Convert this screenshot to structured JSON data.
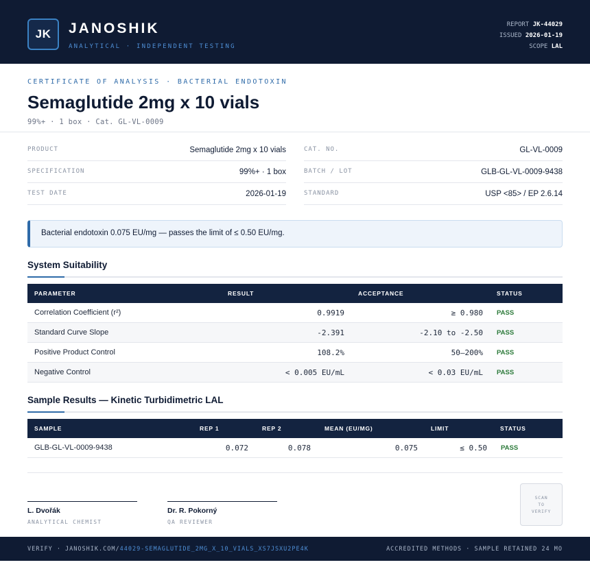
{
  "header": {
    "logo_text": "JK",
    "brand": "JANOSHIK",
    "brand_sub": "ANALYTICAL · INDEPENDENT TESTING",
    "report_label": "REPORT",
    "report_value": "JK-44029",
    "issued_label": "ISSUED",
    "issued_value": "2026-01-19",
    "scope_label": "SCOPE",
    "scope_value": "LAL"
  },
  "title_block": {
    "eyebrow": "CERTIFICATE OF ANALYSIS · BACTERIAL ENDOTOXIN",
    "title": "Semaglutide 2mg x 10 vials",
    "subtitle": "99%+ · 1 box  ·  Cat. GL-VL-0009"
  },
  "info": {
    "product_label": "PRODUCT",
    "product_value": "Semaglutide 2mg x 10 vials",
    "spec_label": "SPECIFICATION",
    "spec_value": "99%+ · 1 box",
    "date_label": "TEST DATE",
    "date_value": "2026-01-19",
    "cat_label": "CAT. NO.",
    "cat_value": "GL-VL-0009",
    "batch_label": "BATCH / LOT",
    "batch_value": "GLB-GL-VL-0009-9438",
    "standard_label": "STANDARD",
    "standard_value": "USP <85> / EP 2.6.14"
  },
  "banner": "Bacterial endotoxin 0.075 EU/mg — passes the limit of ≤ 0.50 EU/mg.",
  "suitability": {
    "title": "System Suitability",
    "headers": {
      "parameter": "PARAMETER",
      "result": "RESULT",
      "acceptance": "ACCEPTANCE",
      "status": "STATUS"
    },
    "rows": [
      {
        "parameter": "Correlation Coefficient (r²)",
        "result": "0.9919",
        "acceptance": "≥ 0.980",
        "status": "PASS"
      },
      {
        "parameter": "Standard Curve Slope",
        "result": "-2.391",
        "acceptance": "-2.10 to -2.50",
        "status": "PASS"
      },
      {
        "parameter": "Positive Product Control",
        "result": "108.2%",
        "acceptance": "50–200%",
        "status": "PASS"
      },
      {
        "parameter": "Negative Control",
        "result": "< 0.005 EU/mL",
        "acceptance": "< 0.03 EU/mL",
        "status": "PASS"
      }
    ]
  },
  "samples": {
    "title": "Sample Results — Kinetic Turbidimetric LAL",
    "headers": {
      "sample": "SAMPLE",
      "rep1": "REP 1",
      "rep2": "REP 2",
      "mean": "MEAN (EU/MG)",
      "limit": "LIMIT",
      "status": "STATUS"
    },
    "rows": [
      {
        "sample": "GLB-GL-VL-0009-9438",
        "rep1": "0.072",
        "rep2": "0.078",
        "mean": "0.075",
        "limit": "≤ 0.50",
        "status": "PASS"
      }
    ]
  },
  "signatures": [
    {
      "name": "L. Dvořák",
      "role": "ANALYTICAL CHEMIST"
    },
    {
      "name": "Dr. R. Pokorný",
      "role": "QA REVIEWER"
    }
  ],
  "qr": {
    "line1": "SCAN",
    "line2": "TO",
    "line3": "VERIFY"
  },
  "footer": {
    "verify_prefix": "VERIFY · JANOSHIK.COM/",
    "verify_link": "44029-SEMAGLUTIDE_2MG_X_10_VIALS_XS7JSXU2PE4K",
    "right": "ACCREDITED METHODS · SAMPLE RETAINED 24 MO"
  },
  "colors": {
    "navy": "#0f1b33",
    "accent": "#2e6aa8",
    "pass": "#2c7a3a"
  }
}
